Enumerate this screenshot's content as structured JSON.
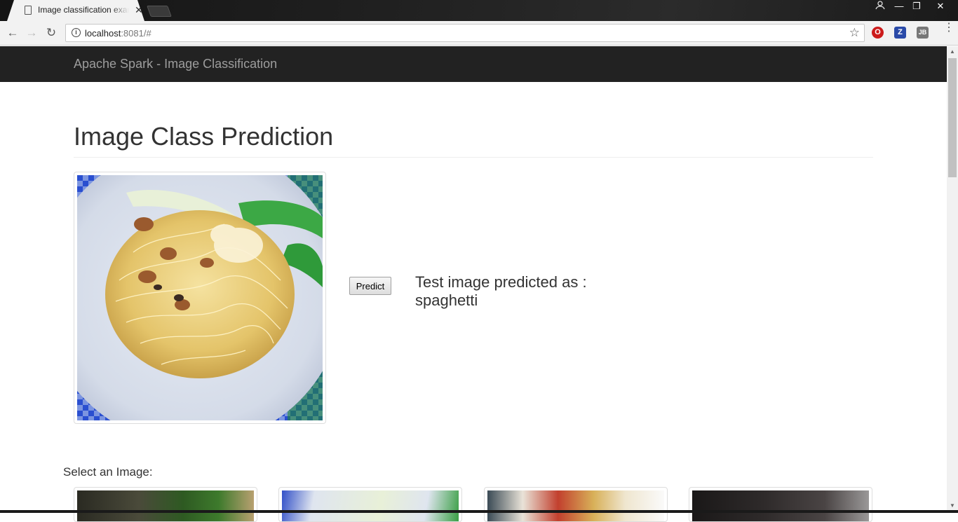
{
  "browser": {
    "tab_title": "Image classification exam",
    "url_host": "localhost",
    "url_rest": ":8081/#",
    "extensions": [
      "opera-icon",
      "z-icon",
      "jb-icon"
    ]
  },
  "navbar": {
    "brand": "Apache Spark - Image Classification"
  },
  "main": {
    "title": "Image Class Prediction",
    "predict_label": "Predict",
    "result_text": "Test image predicted as :",
    "result_value": "spaghetti"
  },
  "gallery": {
    "label": "Select an Image:"
  }
}
